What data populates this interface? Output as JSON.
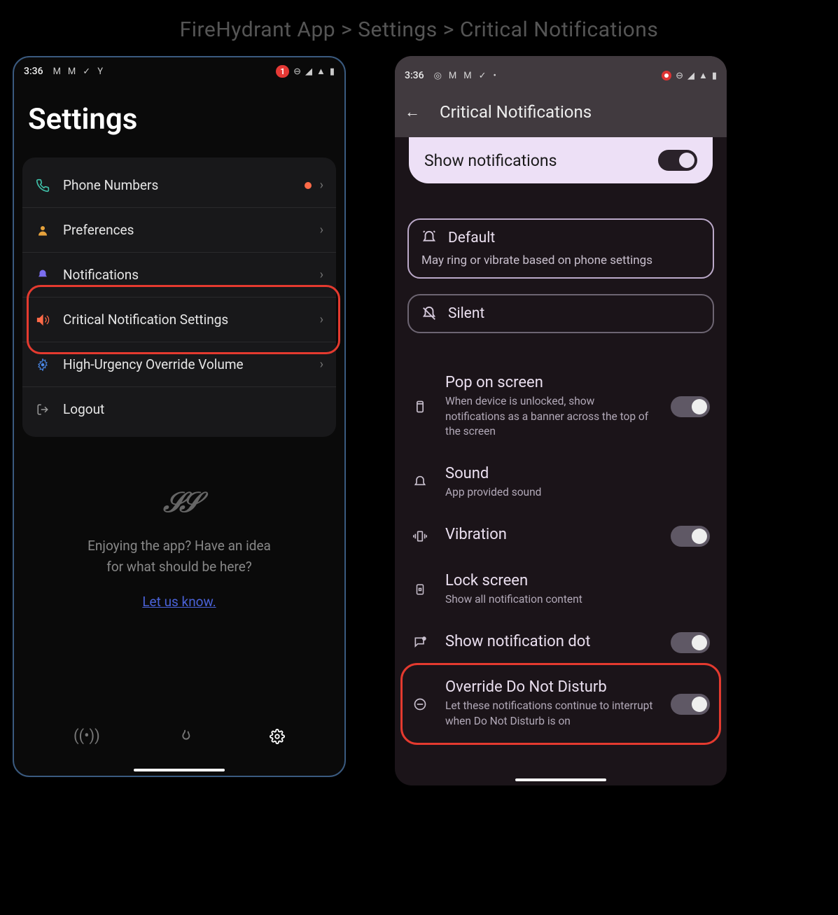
{
  "breadcrumb": "FireHydrant App > Settings > Critical Notifications",
  "left": {
    "status": {
      "time": "3:36",
      "badge": "1"
    },
    "title": "Settings",
    "items": [
      {
        "label": "Phone Numbers"
      },
      {
        "label": "Preferences"
      },
      {
        "label": "Notifications"
      },
      {
        "label": "Critical Notification Settings"
      },
      {
        "label": "High-Urgency Override Volume"
      },
      {
        "label": "Logout"
      }
    ],
    "footer": {
      "line1": "Enjoying the app? Have an idea",
      "line2": "for what should be here?",
      "link": "Let us know."
    }
  },
  "right": {
    "status": {
      "time": "3:36"
    },
    "title": "Critical Notifications",
    "show_notifications": "Show notifications",
    "modes": {
      "default": {
        "label": "Default",
        "desc": "May ring or vibrate based on phone settings"
      },
      "silent": {
        "label": "Silent"
      }
    },
    "rows": {
      "pop": {
        "title": "Pop on screen",
        "desc": "When device is unlocked, show notifications as a banner across the top of the screen"
      },
      "sound": {
        "title": "Sound",
        "desc": "App provided sound"
      },
      "vibration": {
        "title": "Vibration"
      },
      "lock": {
        "title": "Lock screen",
        "desc": "Show all notification content"
      },
      "dot": {
        "title": "Show notification dot"
      },
      "dnd": {
        "title": "Override Do Not Disturb",
        "desc": "Let these notifications continue to interrupt when Do Not Disturb is on"
      }
    }
  }
}
